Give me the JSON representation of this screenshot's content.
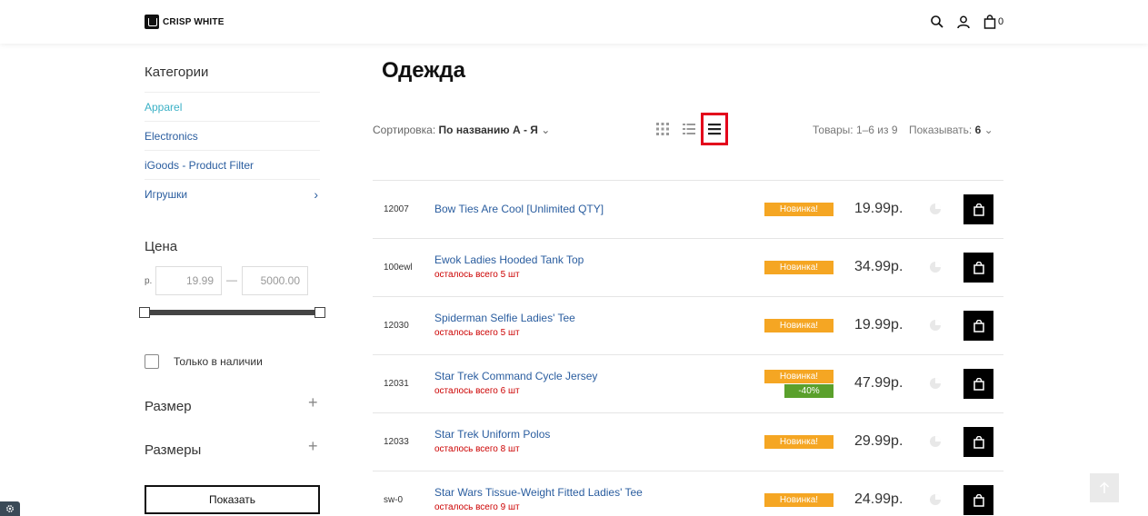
{
  "header": {
    "logo_text": "CRISP WHITE",
    "cart_count": "0",
    "icons": [
      "search-icon",
      "user-icon",
      "shopping-bag-icon"
    ]
  },
  "sidebar": {
    "categories_title": "Категории",
    "categories": [
      {
        "label": "Apparel",
        "active": true,
        "has_children": false
      },
      {
        "label": "Electronics",
        "active": false,
        "has_children": false
      },
      {
        "label": "iGoods - Product Filter",
        "active": false,
        "has_children": false
      },
      {
        "label": "Игрушки",
        "active": false,
        "has_children": true
      }
    ],
    "price_title": "Цена",
    "price_currency": "р.",
    "price_min": "19.99",
    "price_max": "5000.00",
    "price_dash": "—",
    "in_stock_label": "Только в наличии",
    "filters": [
      {
        "label": "Размер"
      },
      {
        "label": "Размеры"
      }
    ],
    "show_button": "Показать"
  },
  "main": {
    "title": "Одежда",
    "sort_label": "Сортировка:",
    "sort_value": "По названию А - Я",
    "view_modes": [
      "grid-view-icon",
      "list-view-icon",
      "compact-list-view-icon"
    ],
    "active_view": "compact-list-view-icon",
    "counts_text": "Товары: 1–6 из 9",
    "per_page_label": "Показывать:",
    "per_page_value": "6",
    "products": [
      {
        "sku": "12007",
        "name": "Bow Ties Are Cool [Unlimited QTY]",
        "stock": "",
        "badges": [
          "Новинка!"
        ],
        "price": "19.99р."
      },
      {
        "sku": "100ewl",
        "name": "Ewok Ladies Hooded Tank Top",
        "stock": "осталось всего 5 шт",
        "badges": [
          "Новинка!"
        ],
        "price": "34.99р."
      },
      {
        "sku": "12030",
        "name": "Spiderman Selfie Ladies' Tee",
        "stock": "осталось всего 5 шт",
        "badges": [
          "Новинка!"
        ],
        "price": "19.99р."
      },
      {
        "sku": "12031",
        "name": "Star Trek Command Cycle Jersey",
        "stock": "осталось всего 6 шт",
        "badges": [
          "Новинка!",
          "-40%"
        ],
        "price": "47.99р."
      },
      {
        "sku": "12033",
        "name": "Star Trek Uniform Polos",
        "stock": "осталось всего 8 шт",
        "badges": [
          "Новинка!"
        ],
        "price": "29.99р."
      },
      {
        "sku": "sw-0",
        "name": "Star Wars Tissue-Weight Fitted Ladies' Tee",
        "stock": "осталось всего 9 шт",
        "badges": [
          "Новинка!"
        ],
        "price": "24.99р."
      }
    ]
  },
  "colors": {
    "link": "#2a5d9f",
    "active_category": "#3bb1c6",
    "badge_new": "#f5a623",
    "badge_sale": "#5aa02c",
    "stock_warning": "#cc0000",
    "highlight": "#e3001b"
  }
}
